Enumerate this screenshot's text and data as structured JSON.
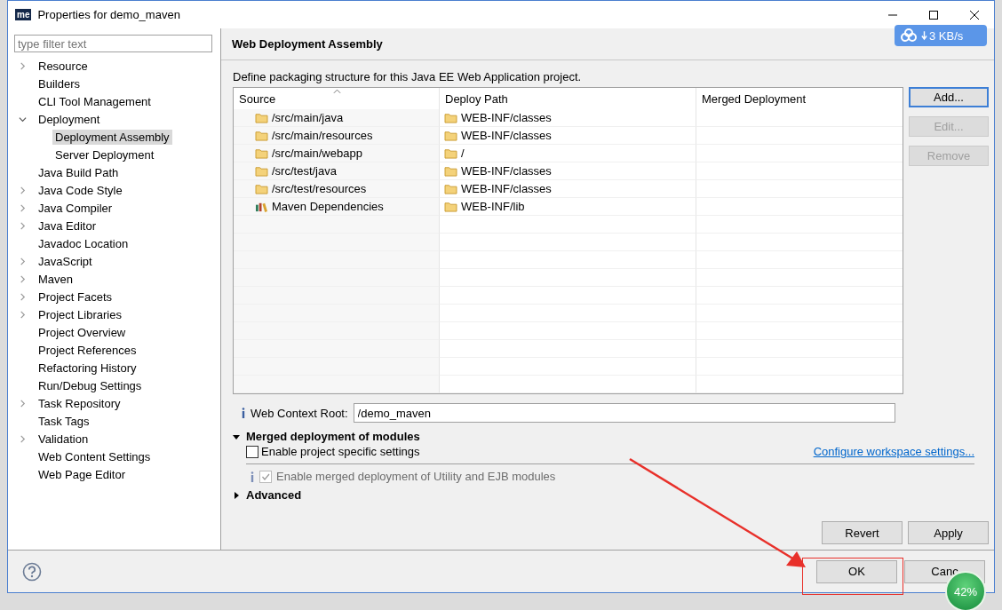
{
  "window": {
    "title": "Properties for demo_maven",
    "app_badge": "me"
  },
  "filter": {
    "placeholder": "type filter text"
  },
  "nav": [
    {
      "label": "Resource",
      "expanded": false,
      "selected": false
    },
    {
      "label": "Builders",
      "selected": false
    },
    {
      "label": "CLI Tool Management",
      "selected": false
    },
    {
      "label": "Deployment",
      "expanded": true,
      "selected": false,
      "children": [
        {
          "label": "Deployment Assembly",
          "selected": true
        },
        {
          "label": "Server Deployment",
          "selected": false
        }
      ]
    },
    {
      "label": "Java Build Path",
      "selected": false
    },
    {
      "label": "Java Code Style",
      "expanded": false,
      "selected": false
    },
    {
      "label": "Java Compiler",
      "expanded": false,
      "selected": false
    },
    {
      "label": "Java Editor",
      "expanded": false,
      "selected": false
    },
    {
      "label": "Javadoc Location",
      "selected": false
    },
    {
      "label": "JavaScript",
      "expanded": false,
      "selected": false
    },
    {
      "label": "Maven",
      "expanded": false,
      "selected": false
    },
    {
      "label": "Project Facets",
      "expanded": false,
      "selected": false
    },
    {
      "label": "Project Libraries",
      "expanded": false,
      "selected": false
    },
    {
      "label": "Project Overview",
      "selected": false
    },
    {
      "label": "Project References",
      "selected": false
    },
    {
      "label": "Refactoring History",
      "selected": false
    },
    {
      "label": "Run/Debug Settings",
      "selected": false
    },
    {
      "label": "Task Repository",
      "expanded": false,
      "selected": false
    },
    {
      "label": "Task Tags",
      "selected": false
    },
    {
      "label": "Validation",
      "expanded": false,
      "selected": false
    },
    {
      "label": "Web Content Settings",
      "selected": false
    },
    {
      "label": "Web Page Editor",
      "selected": false
    }
  ],
  "page": {
    "title": "Web Deployment Assembly",
    "description": "Define packaging structure for this Java EE Web Application project.",
    "columns": [
      "Source",
      "Deploy Path",
      "Merged Deployment"
    ],
    "rows": [
      {
        "source": "/src/main/java",
        "kind": "folder",
        "deploy_path": "WEB-INF/classes"
      },
      {
        "source": "/src/main/resources",
        "kind": "folder",
        "deploy_path": "WEB-INF/classes"
      },
      {
        "source": "/src/main/webapp",
        "kind": "folder",
        "deploy_path": "/"
      },
      {
        "source": "/src/test/java",
        "kind": "folder",
        "deploy_path": "WEB-INF/classes"
      },
      {
        "source": "/src/test/resources",
        "kind": "folder",
        "deploy_path": "WEB-INF/classes"
      },
      {
        "source": "Maven Dependencies",
        "kind": "library",
        "deploy_path": "WEB-INF/lib"
      }
    ],
    "side_buttons": [
      {
        "label": "Add...",
        "disabled": false
      },
      {
        "label": "Edit...",
        "disabled": true
      },
      {
        "label": "Remove",
        "disabled": true
      }
    ],
    "context_root": {
      "label": "Web Context Root:",
      "value": "/demo_maven"
    },
    "merged": {
      "title": "Merged deployment of modules",
      "expanded": true,
      "project_specific": {
        "label": "Enable project specific settings",
        "checked": false
      },
      "link": "Configure workspace settings...",
      "merge_modules": {
        "label": "Enable merged deployment of Utility and EJB modules",
        "checked": true,
        "disabled": true
      }
    },
    "advanced": {
      "title": "Advanced",
      "expanded": false
    },
    "page_buttons": [
      "Revert",
      "Apply"
    ]
  },
  "dialog_buttons": [
    "OK",
    "Canc"
  ],
  "speed_widget": {
    "reading": "3 KB/s"
  },
  "progress_ball": {
    "reading": "42%"
  }
}
